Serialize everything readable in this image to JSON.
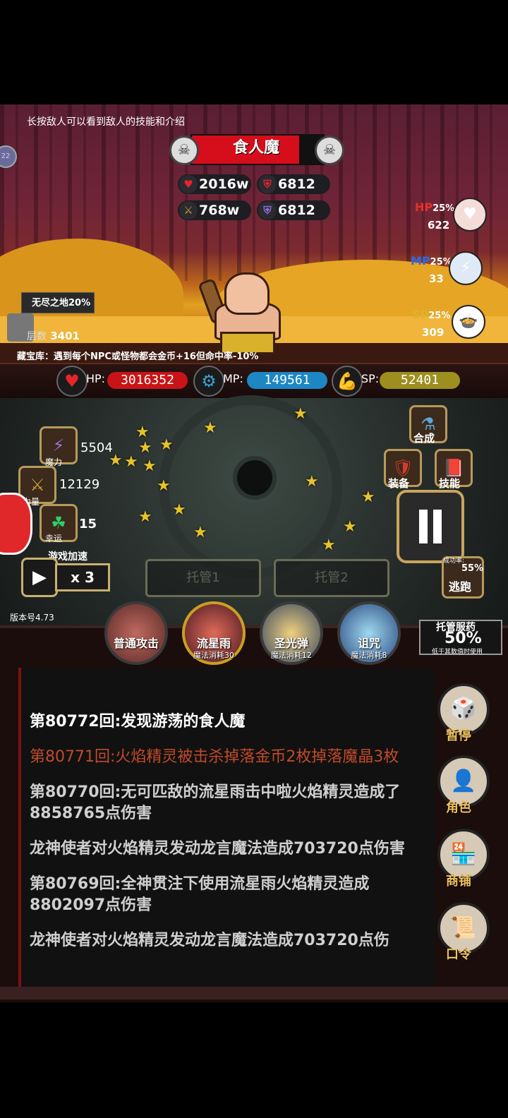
{
  "tip": "长按敌人可以看到敌人的技能和介绍",
  "left_badge": "22",
  "enemy": {
    "name": "食人魔",
    "hp": "2016w",
    "defense": "6812",
    "attack": "768w",
    "magic_defense": "6812"
  },
  "resources": {
    "hp": {
      "label": "HP",
      "percent": "25%",
      "value": "622"
    },
    "mp": {
      "label": "MP",
      "percent": "25%",
      "value": "33"
    },
    "sp": {
      "label": "SP",
      "percent": "25%",
      "value": "309"
    }
  },
  "stage": {
    "name": "无尽之地20%",
    "layer_label": "层数",
    "layer_value": "3401",
    "treasure": "藏宝库：遇到每个NPC或怪物都会金币+16但命中率-10%"
  },
  "player": {
    "hp_label": "HP:",
    "hp_value": "3016352",
    "mp_label": "MP:",
    "mp_value": "149561",
    "sp_label": "SP:",
    "sp_value": "52401"
  },
  "stats": {
    "magic_value": "5504",
    "magic_label": "魔力",
    "strength_value": "12129",
    "strength_label": "力量",
    "luck_value": "15",
    "luck_label": "幸运"
  },
  "speed": {
    "label": "游戏加速",
    "value": "x 3"
  },
  "auto_buttons": [
    "托管1",
    "托管2"
  ],
  "right_actions": {
    "synthesize": "合成",
    "equip": "装备",
    "skill": "技能"
  },
  "escape": {
    "rate_label": "成功率:",
    "rate_value": "55%",
    "label": "逃跑"
  },
  "version": "版本号4.73",
  "skills": [
    {
      "name": "普通攻击",
      "cost": ""
    },
    {
      "name": "流星雨",
      "cost": "魔法消耗30"
    },
    {
      "name": "圣光弹",
      "cost": "魔法消耗12"
    },
    {
      "name": "诅咒",
      "cost": "魔法消耗8"
    }
  ],
  "potion": {
    "title": "托管服药",
    "value": "50%",
    "note": "低于其数值时使用"
  },
  "log": [
    {
      "text": "第80772回:发现游荡的食人魔",
      "style": "bold-white"
    },
    {
      "text": "第80771回:火焰精灵被击杀掉落金币2枚掉落魔晶3枚",
      "style": "red"
    },
    {
      "text": "第80770回:无可匹敌的流星雨击中啦火焰精灵造成了8858765点伤害",
      "style": "gray"
    },
    {
      "text": "龙神使者对火焰精灵发动龙言魔法造成703720点伤害",
      "style": "gray"
    },
    {
      "text": "第80769回:全神贯注下使用流星雨火焰精灵造成8802097点伤害",
      "style": "gray"
    },
    {
      "text": "龙神使者对火焰精灵发动龙言魔法造成703720点伤",
      "style": "gray"
    }
  ],
  "side_menu": [
    "暂停",
    "角色",
    "商铺",
    "口令"
  ],
  "colors": {
    "enemy_bar": "#d60d1a",
    "hp_bar": "#c81418",
    "mp_bar": "#1d87c4",
    "sp_bar": "#9c8f1f",
    "log_red": "#c24a2a"
  }
}
